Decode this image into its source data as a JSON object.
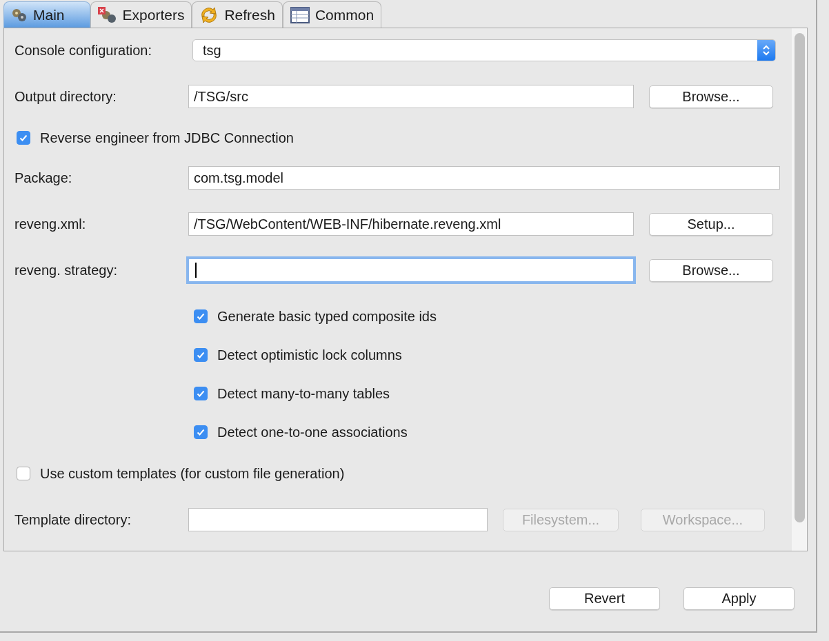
{
  "tabs": [
    {
      "label": "Main",
      "selected": true
    },
    {
      "label": "Exporters",
      "selected": false
    },
    {
      "label": "Refresh",
      "selected": false
    },
    {
      "label": "Common",
      "selected": false
    }
  ],
  "rows": [
    {
      "kind": "select",
      "label": "Console configuration:",
      "value": "tsg"
    },
    {
      "kind": "field_button",
      "label": "Output directory:",
      "value": "/TSG/src",
      "button": {
        "label": "Browse...",
        "disabled": false
      },
      "focused": false
    },
    {
      "kind": "checkbox",
      "label": "Reverse engineer from JDBC Connection",
      "checked": true
    },
    {
      "kind": "field",
      "label": "Package:",
      "value": "com.tsg.model",
      "focused": false
    },
    {
      "kind": "field_button",
      "label": "reveng.xml:",
      "value": "/TSG/WebContent/WEB-INF/hibernate.reveng.xml",
      "button": {
        "label": "Setup...",
        "disabled": false
      },
      "focused": false
    },
    {
      "kind": "field_button",
      "label": "reveng. strategy:",
      "value": "",
      "button": {
        "label": "Browse...",
        "disabled": false
      },
      "focused": true
    },
    {
      "kind": "option",
      "label": "Generate basic typed composite ids",
      "checked": true
    },
    {
      "kind": "option",
      "label": "Detect optimistic lock columns",
      "checked": true
    },
    {
      "kind": "option",
      "label": "Detect many-to-many tables",
      "checked": true
    },
    {
      "kind": "option",
      "label": "Detect one-to-one associations",
      "checked": true
    },
    {
      "kind": "checkbox",
      "label": "Use custom templates (for custom file generation)",
      "checked": false
    },
    {
      "kind": "field_two_buttons",
      "label": "Template directory:",
      "value": "",
      "buttons": [
        {
          "label": "Filesystem...",
          "disabled": true
        },
        {
          "label": "Workspace...",
          "disabled": true
        }
      ]
    }
  ],
  "buttons": [
    {
      "label": "Revert"
    },
    {
      "label": "Apply"
    }
  ]
}
